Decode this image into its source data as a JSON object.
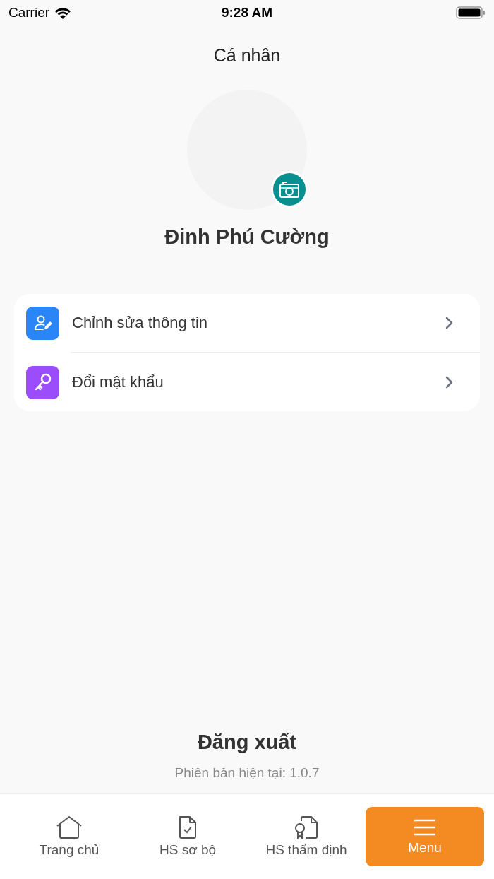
{
  "status_bar": {
    "carrier": "Carrier",
    "time": "9:28 AM"
  },
  "header": {
    "title": "Cá nhân"
  },
  "profile": {
    "name": "Đinh Phú Cường"
  },
  "menu_items": [
    {
      "label": "Chỉnh sửa thông tin",
      "kind": "edit-profile",
      "color": "#2a85f7"
    },
    {
      "label": "Đổi mật khẩu",
      "kind": "key",
      "color": "#9b4dfc"
    }
  ],
  "logout": {
    "label": "Đăng xuất"
  },
  "version": "Phiên bản hiện tại: 1.0.7",
  "tabs": [
    {
      "label": "Trang chủ",
      "kind": "home",
      "selected": false
    },
    {
      "label": "HS sơ bộ",
      "kind": "doc-check",
      "selected": false
    },
    {
      "label": "HS  thẩm định",
      "kind": "doc-award",
      "selected": false
    },
    {
      "label": "Menu",
      "kind": "menu",
      "selected": true
    }
  ]
}
